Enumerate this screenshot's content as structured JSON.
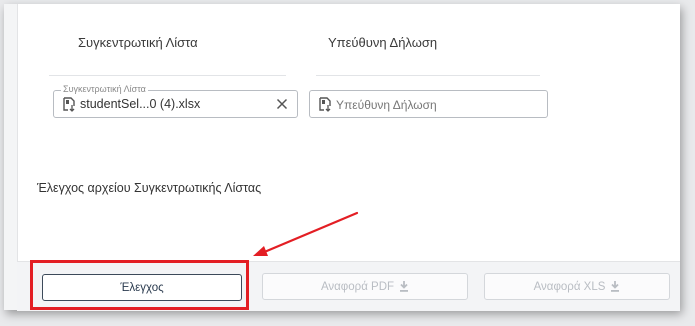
{
  "columns": {
    "summary_list_label": "Συγκεντρωτική Λίστα",
    "declaration_label": "Υπεύθυνη Δήλωση"
  },
  "fields": {
    "summary_list": {
      "legend": "Συγκεντρωτική Λίστα",
      "value": "studentSel...0 (4).xlsx"
    },
    "declaration": {
      "placeholder": "Υπεύθυνη Δήλωση"
    }
  },
  "check_description": "Έλεγχος αρχείου Συγκεντρωτικής Λίστας",
  "buttons": {
    "check": "Έλεγχος",
    "report_pdf": "Αναφορά PDF",
    "report_xls": "Αναφορά XLS"
  },
  "colors": {
    "highlight": "#e31e24",
    "primary_button_border": "#3c4a5a",
    "disabled_text": "#b9bdc3"
  },
  "icons": {
    "file": "file-upload-icon",
    "clear": "close-icon",
    "download": "download-icon"
  }
}
